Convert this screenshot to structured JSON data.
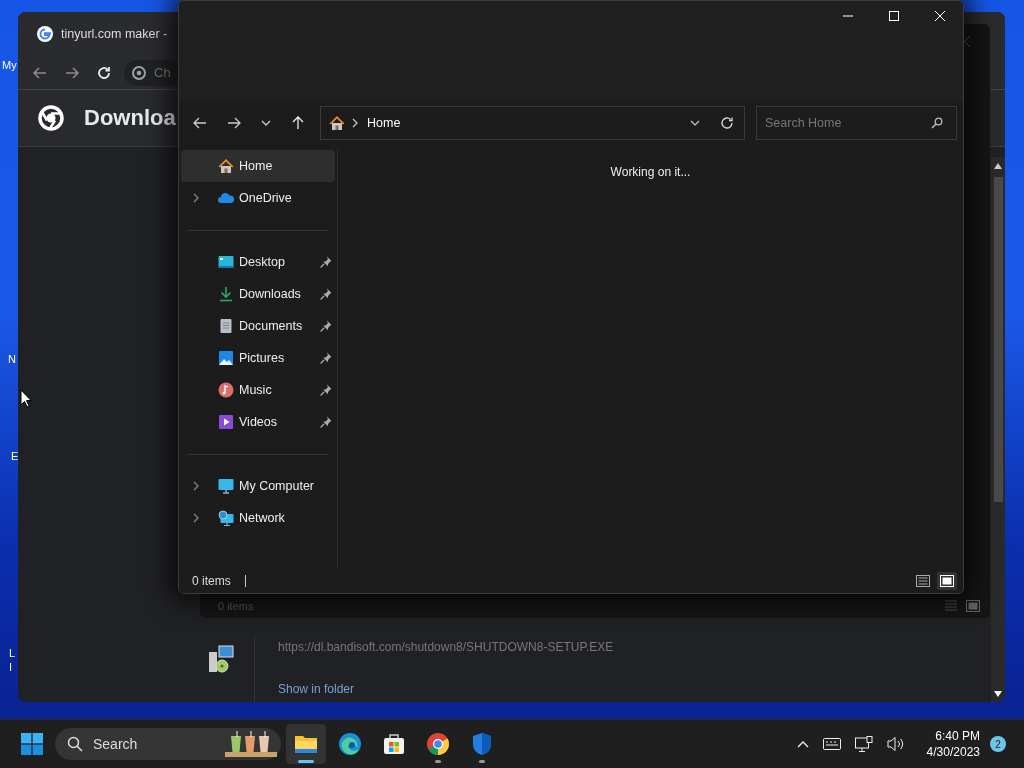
{
  "desktop": {
    "icon_labels": [
      "My",
      "N",
      "E",
      "L",
      "I"
    ]
  },
  "browser": {
    "tab_title": "tinyurl.com maker -",
    "address": "Ch",
    "page_title": "Downloa",
    "download": {
      "url": "https://dl.bandisoft.com/shutdown8/SHUTDOWN8-SETUP.EXE",
      "action": "Show in folder"
    }
  },
  "background_explorer": {
    "status": "0 items"
  },
  "explorer": {
    "address": "Home",
    "search": {
      "placeholder": "Search Home"
    },
    "sidebar_groups": [
      {
        "items": [
          {
            "label": "Home",
            "kind": "home",
            "selected": true,
            "expandable": false,
            "pinned": false
          },
          {
            "label": "OneDrive",
            "kind": "onedrive",
            "selected": false,
            "expandable": true,
            "pinned": false
          }
        ]
      },
      {
        "items": [
          {
            "label": "Desktop",
            "kind": "desktop",
            "selected": false,
            "expandable": false,
            "pinned": true
          },
          {
            "label": "Downloads",
            "kind": "downloads",
            "selected": false,
            "expandable": false,
            "pinned": true
          },
          {
            "label": "Documents",
            "kind": "documents",
            "selected": false,
            "expandable": false,
            "pinned": true
          },
          {
            "label": "Pictures",
            "kind": "pictures",
            "selected": false,
            "expandable": false,
            "pinned": true
          },
          {
            "label": "Music",
            "kind": "music",
            "selected": false,
            "expandable": false,
            "pinned": true
          },
          {
            "label": "Videos",
            "kind": "videos",
            "selected": false,
            "expandable": false,
            "pinned": true
          }
        ]
      },
      {
        "items": [
          {
            "label": "My Computer",
            "kind": "computer",
            "selected": false,
            "expandable": true,
            "pinned": false
          },
          {
            "label": "Network",
            "kind": "network",
            "selected": false,
            "expandable": true,
            "pinned": false
          }
        ]
      }
    ],
    "message": "Working on it...",
    "status": "0 items",
    "views": [
      {
        "kind": "details",
        "selected": false
      },
      {
        "kind": "tiles",
        "selected": true
      }
    ]
  },
  "taskbar": {
    "search": "Search",
    "apps": [
      {
        "kind": "explorer",
        "selected": true,
        "running": true
      },
      {
        "kind": "edge",
        "selected": false,
        "running": false
      },
      {
        "kind": "store",
        "selected": false,
        "running": false
      },
      {
        "kind": "chrome",
        "selected": false,
        "running": true
      },
      {
        "kind": "defender",
        "selected": false,
        "running": true
      }
    ],
    "time": "6:40 PM",
    "date": "4/30/2023",
    "notifications": "2"
  }
}
